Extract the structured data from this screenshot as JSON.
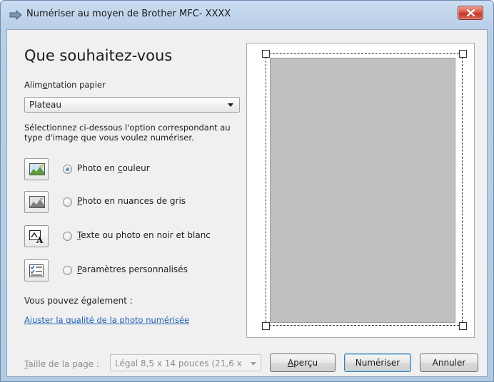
{
  "window": {
    "title": "Numériser au moyen de Brother MFC- XXXX"
  },
  "main": {
    "heading": "Que souhaitez-vous",
    "paper_feed": {
      "label_pre": "Alim",
      "label_u": "e",
      "label_post": "ntation papier",
      "selected": "Plateau"
    },
    "description": "Sélectionnez ci-dessous l'option correspondant au type d'image que vous voulez numériser.",
    "options": [
      {
        "pre": "Photo en ",
        "u": "c",
        "post": "ouleur",
        "selected": true,
        "icon": "color-photo-icon"
      },
      {
        "pre": "",
        "u": "P",
        "post": "hoto en nuances de gris",
        "selected": false,
        "icon": "grayscale-photo-icon"
      },
      {
        "pre": "",
        "u": "T",
        "post": "exte ou photo en noir et blanc",
        "selected": false,
        "icon": "text-bw-icon"
      },
      {
        "pre": "",
        "u": "P",
        "post": "aramètres personnalisés",
        "selected": false,
        "icon": "custom-settings-icon"
      }
    ],
    "also_label": "Vous pouvez également :",
    "adjust_link": {
      "u": "A",
      "rest": "juster la qualité de la photo numérisée"
    }
  },
  "bottom": {
    "page_size_label_u": "T",
    "page_size_label_rest": "aille de la page :",
    "page_size_value": "Légal 8,5 x 14 pouces (21,6 x",
    "preview_pre": "",
    "preview_u": "A",
    "preview_post": "perçu",
    "scan_label": "Numériser",
    "cancel_label": "Annuler"
  },
  "colors": {
    "link": "#1e5fb3",
    "close_button": "#c2392a",
    "preview_page": "#c0c0c0"
  }
}
